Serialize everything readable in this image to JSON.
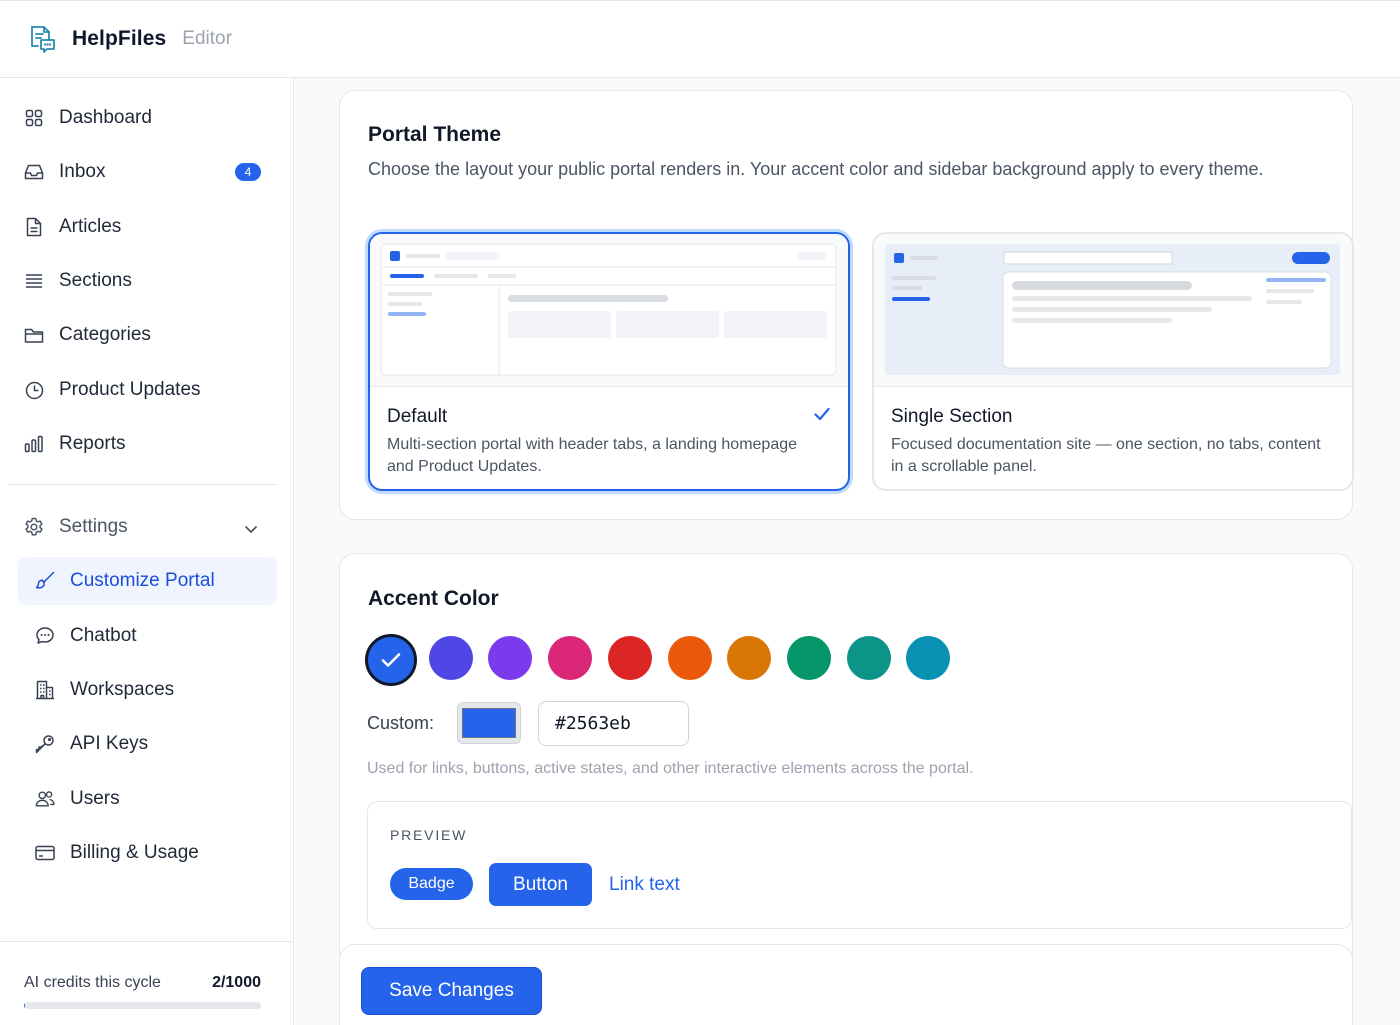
{
  "header": {
    "brand": "HelpFiles",
    "subtitle": "Editor",
    "logo_icon": "chat-document-icon"
  },
  "sidebar": {
    "items": [
      {
        "label": "Dashboard",
        "icon": "grid-icon"
      },
      {
        "label": "Inbox",
        "icon": "inbox-icon",
        "badge": "4"
      },
      {
        "label": "Articles",
        "icon": "document-icon"
      },
      {
        "label": "Sections",
        "icon": "list-icon"
      },
      {
        "label": "Categories",
        "icon": "folder-icon"
      },
      {
        "label": "Product Updates",
        "icon": "clock-icon"
      },
      {
        "label": "Reports",
        "icon": "bar-chart-icon"
      }
    ],
    "settings": {
      "label": "Settings",
      "icon": "gear-icon"
    },
    "sub_items": [
      {
        "label": "Customize Portal",
        "icon": "brush-icon",
        "active": true
      },
      {
        "label": "Chatbot",
        "icon": "chat-bubble-icon"
      },
      {
        "label": "Workspaces",
        "icon": "building-icon"
      },
      {
        "label": "API Keys",
        "icon": "key-icon"
      },
      {
        "label": "Users",
        "icon": "users-icon"
      },
      {
        "label": "Billing & Usage",
        "icon": "credit-card-icon"
      }
    ],
    "credits": {
      "label": "AI credits this cycle",
      "value": "2/1000",
      "used": 2,
      "total": 1000
    }
  },
  "theme_card": {
    "title": "Portal Theme",
    "description": "Choose the layout your public portal renders in. Your accent color and sidebar background apply to every theme.",
    "options": [
      {
        "title": "Default",
        "description": "Multi-section portal with header tabs, a landing homepage and Product Updates.",
        "selected": true
      },
      {
        "title": "Single Section",
        "description": "Focused documentation site — one section, no tabs, content in a scrollable panel.",
        "selected": false
      }
    ]
  },
  "accent_card": {
    "title": "Accent Color",
    "swatches": [
      "#2563eb",
      "#4f46e5",
      "#7c3aed",
      "#db2777",
      "#dc2626",
      "#ea580c",
      "#d97706",
      "#059669",
      "#0d9488",
      "#0891b2"
    ],
    "selected_swatch": "#2563eb",
    "custom_label": "Custom:",
    "custom_value": "#2563eb",
    "help": "Used for links, buttons, active states, and other interactive elements across the portal.",
    "preview": {
      "label": "PREVIEW",
      "badge": "Badge",
      "button": "Button",
      "link": "Link text"
    }
  },
  "footer": {
    "save_label": "Save Changes"
  }
}
